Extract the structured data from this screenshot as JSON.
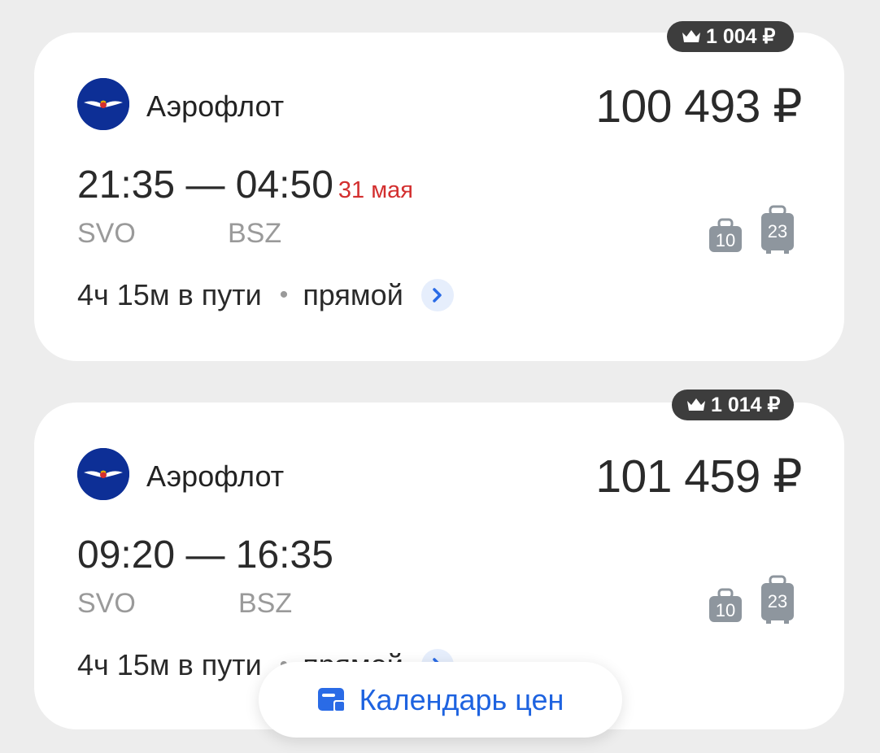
{
  "flights": [
    {
      "cashback": "1 004 ₽",
      "airline": "Аэрофлот",
      "price": "100 493 ₽",
      "times": "21:35 — 04:50",
      "next_day_label": "31 мая",
      "from_code": "SVO",
      "to_code": "BSZ",
      "duration": "4ч 15м в пути",
      "stops": "прямой",
      "hand_baggage_kg": "10",
      "checked_baggage_kg": "23"
    },
    {
      "cashback": "1 014 ₽",
      "airline": "Аэрофлот",
      "price": "101 459 ₽",
      "times": "09:20 — 16:35",
      "from_code": "SVO",
      "to_code": "BSZ",
      "duration": "4ч 15м в пути",
      "stops": "прямой",
      "hand_baggage_kg": "10",
      "checked_baggage_kg": "23"
    }
  ],
  "calendar_button": {
    "label": "Календарь цен"
  },
  "icons": {
    "cashback": "crown-icon",
    "airline_logo": "aeroflot-logo-icon",
    "details": "chevron-right-icon",
    "hand_baggage": "hand-baggage-icon",
    "checked_baggage": "checked-baggage-icon",
    "calendar": "calendar-icon"
  },
  "colors": {
    "accent": "#1e63e0",
    "next_day": "#d32f2f",
    "logo_bg": "#0d2f96",
    "cashback_bg": "#3d3d3d"
  }
}
